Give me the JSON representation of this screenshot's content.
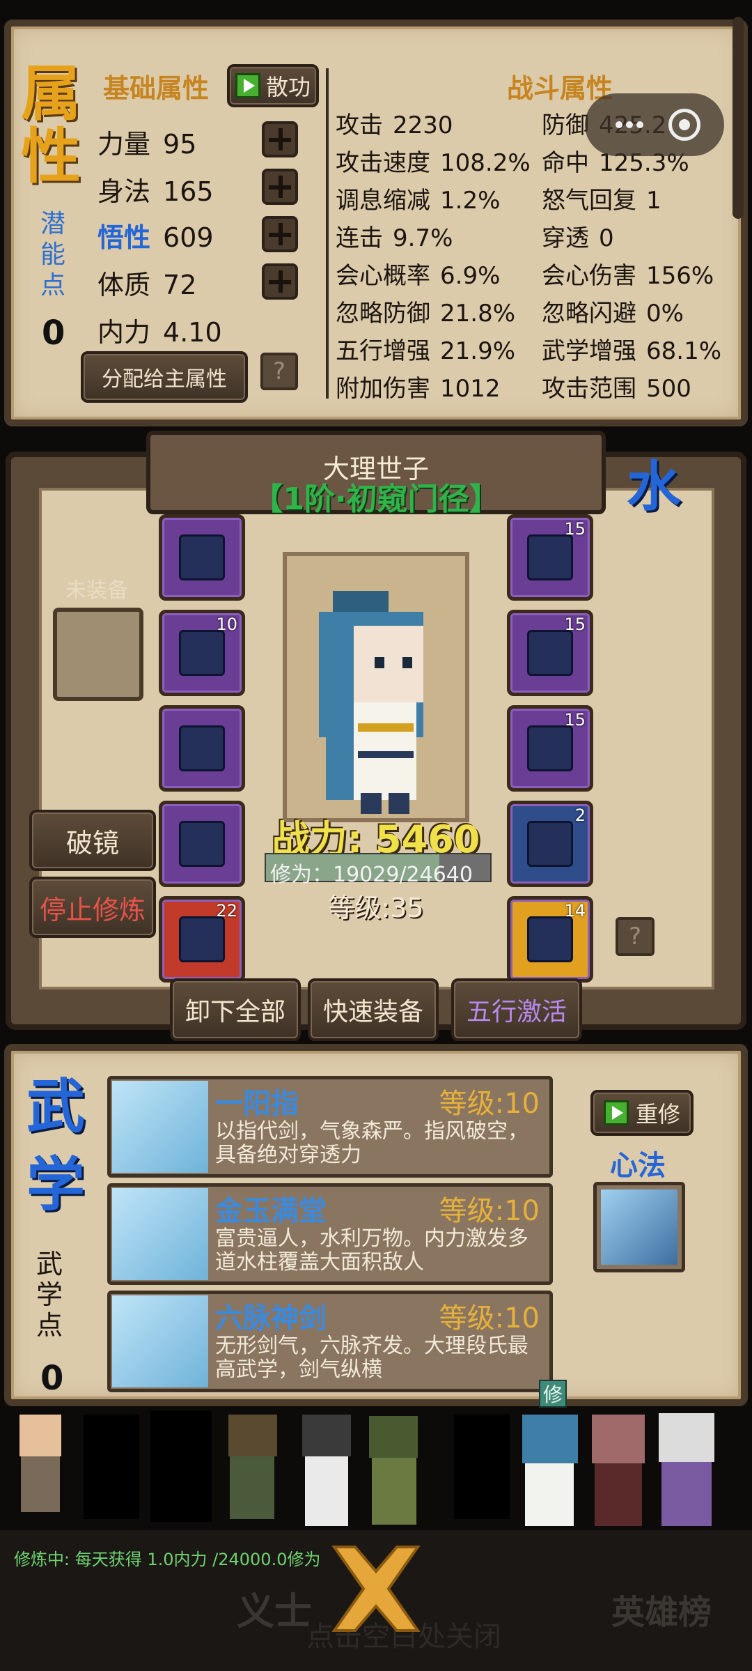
{
  "attributes": {
    "title": "属性",
    "potential_label": "潜能点",
    "potential_value": "0",
    "basic_title": "基础属性",
    "scatter_btn": "散功",
    "rows": [
      {
        "label": "力量",
        "value": "95"
      },
      {
        "label": "身法",
        "value": "165"
      },
      {
        "label": "悟性",
        "value": "609"
      },
      {
        "label": "体质",
        "value": "72"
      },
      {
        "label": "内力",
        "value": "4.10"
      }
    ],
    "assign_btn": "分配给主属性",
    "help": "?"
  },
  "combat": {
    "title": "战斗属性",
    "stats": [
      [
        "攻击",
        "2230"
      ],
      [
        "防御",
        "425.2"
      ],
      [
        "攻击速度",
        "108.2%"
      ],
      [
        "命中",
        "125.3%"
      ],
      [
        "调息缩减",
        "1.2%"
      ],
      [
        "怒气回复",
        "1"
      ],
      [
        "连击",
        "9.7%"
      ],
      [
        "穿透",
        "0"
      ],
      [
        "会心概率",
        "6.9%"
      ],
      [
        "会心伤害",
        "156%"
      ],
      [
        "忽略防御",
        "21.8%"
      ],
      [
        "忽略闪避",
        "0%"
      ],
      [
        "五行增强",
        "21.9%"
      ],
      [
        "武学增强",
        "68.1%"
      ],
      [
        "附加伤害",
        "1012"
      ],
      [
        "攻击范围",
        "500"
      ]
    ]
  },
  "character": {
    "name": "大理世子",
    "rank": "【1阶·初窥门径】",
    "element": "水",
    "unequipped_label": "未装备",
    "power": "战力: 5460",
    "cultivation_text": "修为：19029/24640",
    "cultivation_progress": 0.772,
    "level": "等级:35",
    "left_slots": [
      {
        "level": ""
      },
      {
        "level": "10"
      },
      {
        "level": ""
      },
      {
        "level": ""
      },
      {
        "level": "22"
      }
    ],
    "right_slots": [
      {
        "level": "15"
      },
      {
        "level": "15"
      },
      {
        "level": "15"
      },
      {
        "level": "2"
      },
      {
        "level": "14"
      }
    ],
    "breakthrough_btn": "破镜",
    "stop_btn": "停止修炼",
    "unequip_all_btn": "卸下全部",
    "quick_equip_btn": "快速装备",
    "five_elements_btn": "五行激活",
    "help": "?"
  },
  "martial": {
    "title": "武学",
    "points_label": "武学点",
    "points_value": "0",
    "relearn_btn": "重修",
    "heart_label": "心法",
    "skills": [
      {
        "name": "一阳指",
        "level": "等级:10",
        "desc": "以指代剑，气象森严。指风破空，具备绝对穿透力"
      },
      {
        "name": "金玉满堂",
        "level": "等级:10",
        "desc": "富贵逼人，水利万物。内力激发多道水柱覆盖大面积敌人"
      },
      {
        "name": "六脉神剑",
        "level": "等级:10",
        "desc": "无形剑气，六脉齐发。大理段氏最高武学，剑气纵横"
      }
    ]
  },
  "roster": {
    "cultivating_tag": "修",
    "status_text": "修炼中: 每天获得 1.0内力 /24000.0修为"
  },
  "bottom": {
    "left_label": "义士",
    "right_label": "英雄榜",
    "hint": "点击空白处关闭"
  },
  "colors": {
    "parchment": "#dccbaa",
    "frame": "#4a3a2a",
    "gold": "#e7a21c",
    "blue_title": "#2466d8",
    "power_yellow": "#f0e04a",
    "green_rank": "#2fb34a"
  }
}
